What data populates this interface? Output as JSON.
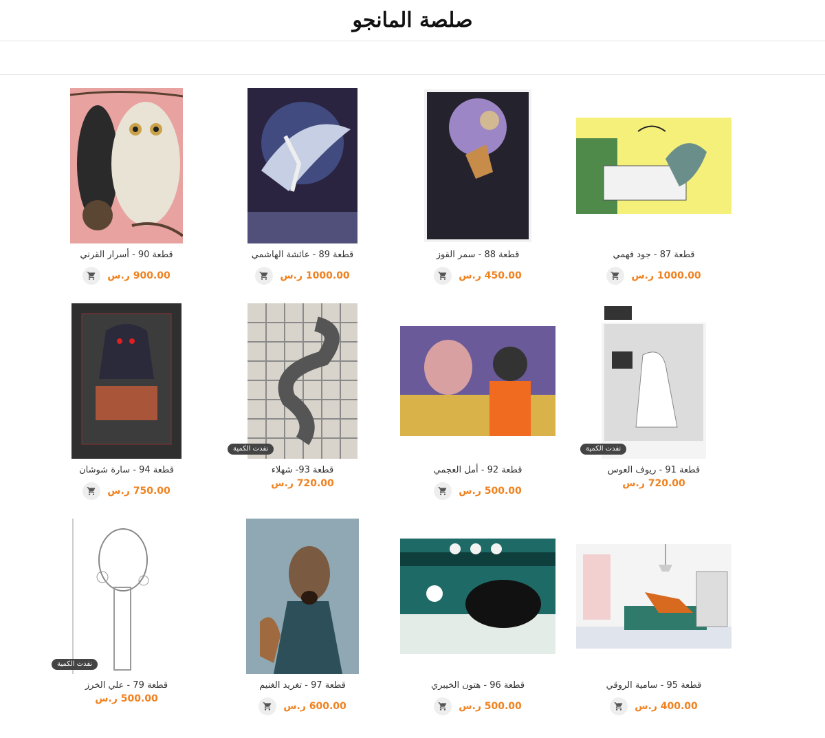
{
  "site": {
    "logo_text": "صلصة المانجو"
  },
  "colors": {
    "price": "#f0811f",
    "badge_bg": "#444444"
  },
  "products": [
    {
      "title": "قطعة 90 - أسرار القرني",
      "price": "900.00 ر.س",
      "has_cart": true,
      "badge": ""
    },
    {
      "title": "قطعة 89 - عائشة الهاشمي",
      "price": "1000.00 ر.س",
      "has_cart": true,
      "badge": ""
    },
    {
      "title": "قطعة 88 - سمر القوز",
      "price": "450.00 ر.س",
      "has_cart": true,
      "badge": ""
    },
    {
      "title": "قطعة 87 - جود فهمي",
      "price": "1000.00 ر.س",
      "has_cart": true,
      "badge": ""
    },
    {
      "title": "قطعة 94 - سارة شوشان",
      "price": "750.00 ر.س",
      "has_cart": true,
      "badge": ""
    },
    {
      "title": "قطعة 93- شهلاء",
      "price": "720.00 ر.س",
      "has_cart": false,
      "badge": "نفدت الكمية"
    },
    {
      "title": "قطعة 92 - أمل العجمي",
      "price": "500.00 ر.س",
      "has_cart": true,
      "badge": ""
    },
    {
      "title": "قطعة 91 - ريوف العوس",
      "price": "720.00 ر.س",
      "has_cart": false,
      "badge": "نفدت الكمية"
    },
    {
      "title": "قطعة 79 - علي الخرز",
      "price": "500.00 ر.س",
      "has_cart": false,
      "badge": "نفدت الكمية"
    },
    {
      "title": "قطعة 97 - تغريد الغنيم",
      "price": "600.00 ر.س",
      "has_cart": true,
      "badge": ""
    },
    {
      "title": "قطعة 96 - هتون الخيبري",
      "price": "500.00 ر.س",
      "has_cart": true,
      "badge": ""
    },
    {
      "title": "قطعة 95 - سامية الروقي",
      "price": "400.00 ر.س",
      "has_cart": true,
      "badge": ""
    }
  ],
  "artwork_images": [
    "owl-and-bat-painting",
    "shark-and-mermaid-painting",
    "moon-and-kangaroo-painting",
    "duck-playing-piano-painting",
    "grim-reaper-desk-painting",
    "eel-knot-grid-painting",
    "cow-and-diver-painting",
    "duck-newsroom-painting",
    "pencil-sketch-scepter",
    "dog-in-coat-painting",
    "bull-and-birds-painting",
    "living-room-illustration"
  ]
}
